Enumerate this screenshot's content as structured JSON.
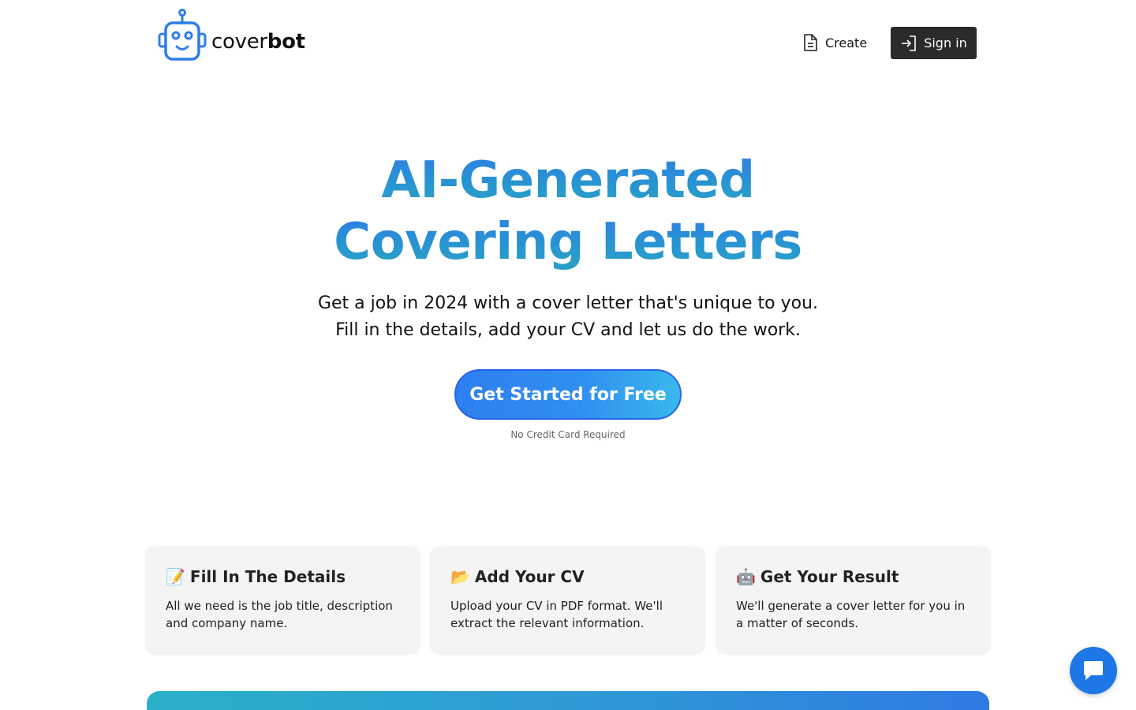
{
  "brand": {
    "name_light": "cover",
    "name_bold": "bot",
    "color": "#2f7de8"
  },
  "nav": {
    "create_label": "Create",
    "create_icon": "document-icon",
    "signin_label": "Sign in",
    "signin_icon": "login-arrow-icon"
  },
  "hero": {
    "title_line1": "AI-Generated",
    "title_line2": "Covering Letters",
    "subtitle_line1": "Get a job in 2024 with a cover letter that's unique to you.",
    "subtitle_line2": "Fill in the details, add your CV and let us do the work.",
    "cta_label": "Get Started for Free",
    "cta_note": "No Credit Card Required"
  },
  "features": [
    {
      "emoji": "📝",
      "title": "Fill In The Details",
      "description": "All we need is the job title, description and company name."
    },
    {
      "emoji": "📂",
      "title": "Add Your CV",
      "description": "Upload your CV in PDF format. We'll extract the relevant information."
    },
    {
      "emoji": "🤖",
      "title": "Get Your Result",
      "description": "We'll generate a cover letter for you in a matter of seconds."
    }
  ],
  "chat": {
    "icon": "chat-bubble-icon",
    "color": "#1d77e6"
  }
}
